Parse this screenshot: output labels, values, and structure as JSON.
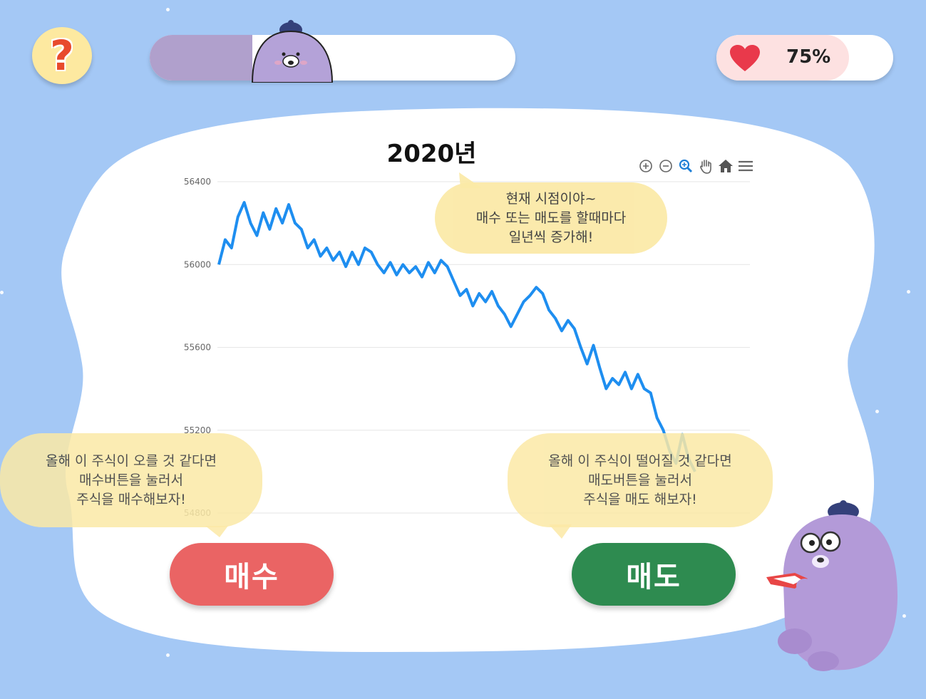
{
  "help": {
    "symbol": "?"
  },
  "progress": {
    "fraction": 0.28
  },
  "heart": {
    "value_text": "75%",
    "fraction": 0.75,
    "color": "#e9394b"
  },
  "chart_data": {
    "type": "line",
    "title": "2020년",
    "y_ticks": [
      "56400",
      "56000",
      "55600",
      "55200",
      "54800"
    ],
    "ylim": [
      54800,
      56400
    ],
    "color": "#1e8ef0",
    "values": [
      56000,
      56120,
      56080,
      56230,
      56300,
      56200,
      56140,
      56250,
      56170,
      56270,
      56200,
      56290,
      56200,
      56170,
      56080,
      56120,
      56040,
      56080,
      56020,
      56060,
      55990,
      56060,
      56000,
      56080,
      56060,
      56000,
      55960,
      56010,
      55950,
      56000,
      55960,
      55990,
      55940,
      56010,
      55960,
      56020,
      55990,
      55920,
      55850,
      55880,
      55800,
      55860,
      55820,
      55870,
      55800,
      55760,
      55700,
      55760,
      55820,
      55850,
      55890,
      55860,
      55780,
      55740,
      55680,
      55730,
      55690,
      55600,
      55520,
      55610,
      55500,
      55400,
      55450,
      55420,
      55480,
      55400,
      55470,
      55400,
      55380,
      55260,
      55200,
      55100,
      55040,
      55180,
      55060,
      55000
    ]
  },
  "toolbar": [
    "zoom-in",
    "zoom-out",
    "magnifier",
    "pan",
    "home",
    "menu"
  ],
  "bubbles": {
    "current": [
      "현재 시점이야~",
      "매수 또는 매도를 할때마다",
      "일년씩 증가해!"
    ],
    "buy": [
      "올해 이 주식이 오를 것 같다면",
      "매수버튼을 눌러서",
      "주식을 매수해보자!"
    ],
    "sell": [
      "올해 이 주식이 떨어질 것 같다면",
      "매도버튼을 눌러서",
      "주식을 매도 해보자!"
    ]
  },
  "buttons": {
    "buy": "매수",
    "sell": "매도"
  },
  "colors": {
    "background": "#a4c8f5",
    "buy": "#ea6464",
    "sell": "#2e8b50",
    "bubble": "#fbe9a6"
  }
}
